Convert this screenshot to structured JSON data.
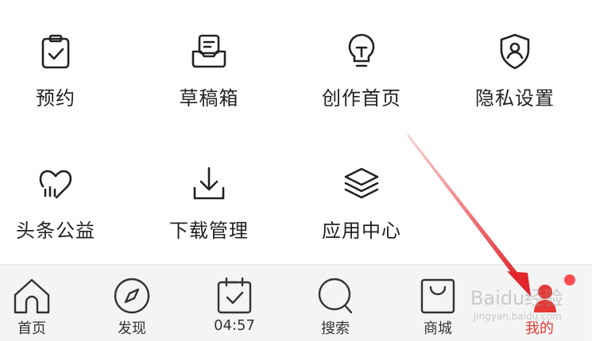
{
  "grid": {
    "items": [
      {
        "label": "预约",
        "icon": "clipboard-check-icon"
      },
      {
        "label": "草稿箱",
        "icon": "drafts-tray-icon"
      },
      {
        "label": "创作首页",
        "icon": "lightbulb-icon"
      },
      {
        "label": "隐私设置",
        "icon": "shield-user-icon"
      },
      {
        "label": "头条公益",
        "icon": "heart-charity-icon"
      },
      {
        "label": "下载管理",
        "icon": "download-icon"
      },
      {
        "label": "应用中心",
        "icon": "layers-icon"
      }
    ]
  },
  "tabbar": {
    "tabs": [
      {
        "label": "首页",
        "icon": "home-icon"
      },
      {
        "label": "发现",
        "icon": "compass-icon"
      },
      {
        "label": "04:57",
        "icon": "calendar-check-icon"
      },
      {
        "label": "搜索",
        "icon": "search-icon"
      },
      {
        "label": "商城",
        "icon": "shopping-bag-icon"
      },
      {
        "label": "我的",
        "icon": "profile-icon"
      }
    ],
    "active_index": 5,
    "active_color": "#e53935"
  },
  "watermark": {
    "line1": "Baidu经验",
    "line2": "jingyan.baidu.com"
  },
  "annotation": {
    "arrow_color": "#e0262b",
    "notification_dot_color": "#ff4d4f"
  }
}
